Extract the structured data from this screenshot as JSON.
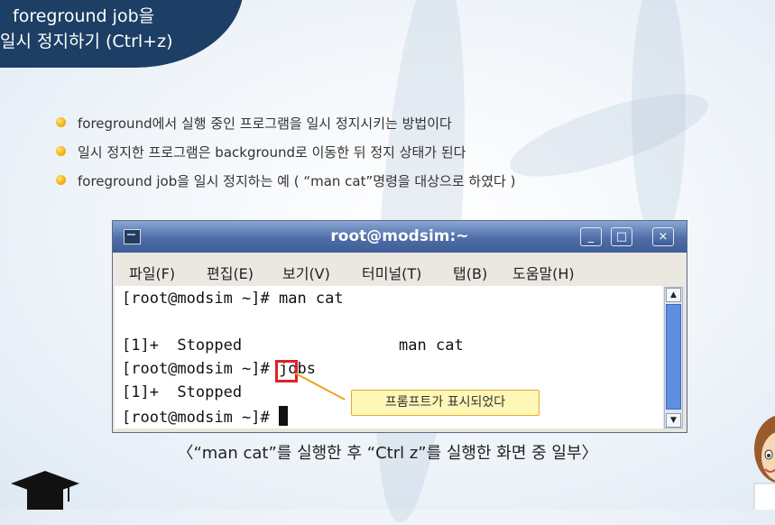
{
  "slide": {
    "title_line1": "foreground job을",
    "title_line2": "일시 정지하기 (Ctrl+z)",
    "bullets": [
      "foreground에서 실행 중인 프로그램을 일시 정지시키는 방법이다",
      "일시 정지한 프로그램은 background로 이동한 뒤 정지 상태가 된다",
      "foreground job을 일시 정지하는 예 ( “man cat”명령을 대상으로 하였다 )"
    ],
    "caption": "〈“man cat”를 실행한 후 “Ctrl z”를 실행한 화면 중 일부〉"
  },
  "window": {
    "title": "root@modsim:~",
    "buttons": {
      "minimize": "_",
      "maximize": "□",
      "close": "×"
    },
    "menu": [
      "파일(F)",
      "편집(E)",
      "보기(V)",
      "터미널(T)",
      "탭(B)",
      "도움말(H)"
    ],
    "terminal_lines": [
      "[root@modsim ~]# man cat",
      "",
      "[1]+  Stopped                 man cat",
      "[root@modsim ~]# jobs",
      "[1]+  Stopped",
      "[root@modsim ~]# "
    ],
    "scroll_up": "▲",
    "scroll_down": "▼"
  },
  "annotation": {
    "text": "프롬프트가 표시되었다"
  },
  "colors": {
    "title_bg": "#1d3f66",
    "highlight": "#e0202a",
    "callout_bg": "#fff7b8",
    "bullet": "#f0a800"
  },
  "icons": [
    "terminal-app-icon",
    "graduation-cap-icon",
    "teacher-character-icon",
    "bullet-dot-icon"
  ]
}
